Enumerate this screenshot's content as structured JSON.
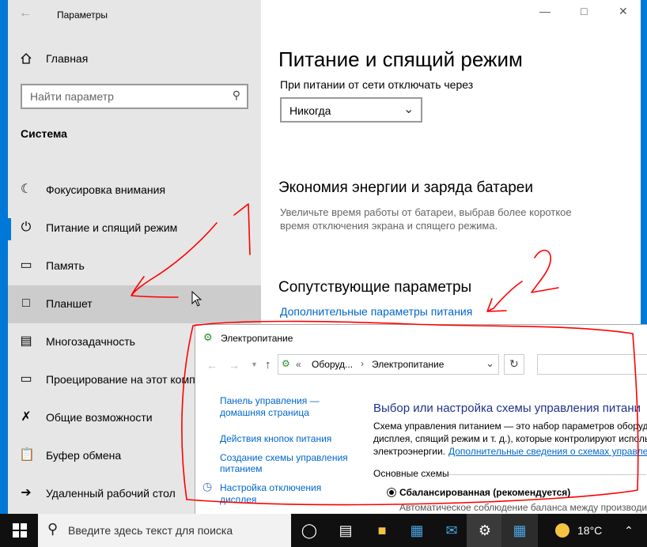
{
  "settings": {
    "title": "Параметры",
    "home": "Главная",
    "search_placeholder": "Найти параметр",
    "section": "Система",
    "nav": [
      {
        "label": "Фокусировка внимания",
        "icon": "moon-icon"
      },
      {
        "label": "Питание и спящий режим",
        "icon": "power-icon"
      },
      {
        "label": "Память",
        "icon": "storage-icon"
      },
      {
        "label": "Планшет",
        "icon": "tablet-icon"
      },
      {
        "label": "Многозадачность",
        "icon": "multitasking-icon"
      },
      {
        "label": "Проецирование на этот компьютер",
        "icon": "projection-icon"
      },
      {
        "label": "Общие возможности",
        "icon": "shared-experiences-icon"
      },
      {
        "label": "Буфер обмена",
        "icon": "clipboard-icon"
      },
      {
        "label": "Удаленный рабочий стол",
        "icon": "remote-desktop-icon"
      }
    ],
    "page_title": "Питание и спящий режим",
    "sleep_label": "При питании от сети отключать через",
    "sleep_value": "Никогда",
    "saver_title": "Экономия энергии и заряда батареи",
    "saver_desc_1": "Увеличьте время работы от батареи, выбрав более короткое",
    "saver_desc_2": "время отключения экрана и спящего режима.",
    "related_title": "Сопутствующие параметры",
    "related_link": "Дополнительные параметры питания"
  },
  "annotations": {
    "mark_1": "1",
    "mark_2": "2",
    "color": "#ff0000"
  },
  "control_panel": {
    "title": "Электропитание",
    "breadcrumb_prefix": "«",
    "breadcrumb_1": "Оборуд...",
    "breadcrumb_sep": "›",
    "breadcrumb_2": "Электропитание",
    "side_home_1": "Панель управления —",
    "side_home_2": "домашняя страница",
    "side_buttons": "Действия кнопок питания",
    "side_create_1": "Создание схемы управления",
    "side_create_2": "питанием",
    "side_display_1": "Настройка отключения",
    "side_display_2": "дисплея",
    "heading": "Выбор или настройка схемы управления питани",
    "desc_1": "Схема управления питанием — это набор параметров оборуд",
    "desc_2": "дисплея, спящий режим и т. д.), которые контролируют исполь",
    "desc_3": "электроэнергии.",
    "desc_link": "Дополнительные сведения о схемах управле",
    "schemes_label": "Основные схемы",
    "scheme_name": "Сбалансированная (рекомендуется)",
    "scheme_desc": "Автоматическое соблюдение баланса между производит"
  },
  "taskbar": {
    "search_placeholder": "Введите здесь текст для поиска",
    "temperature": "18°C"
  }
}
